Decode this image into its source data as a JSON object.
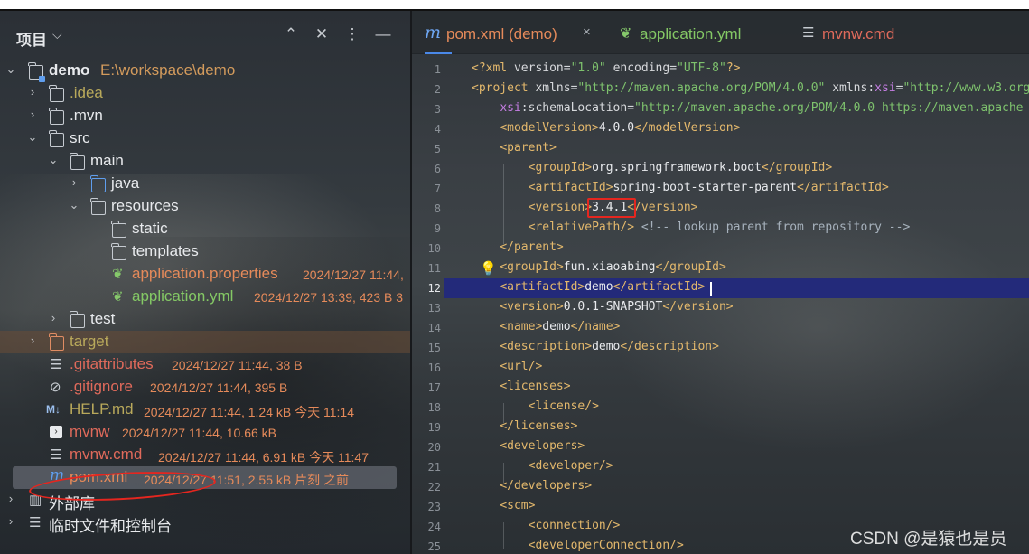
{
  "project_panel": {
    "title": "项目",
    "icons": [
      "expand-all-icon",
      "collapse-all-icon",
      "more-options-icon",
      "minimize-icon"
    ]
  },
  "tree": {
    "root": {
      "name": "demo",
      "path": "E:\\workspace\\demo"
    },
    "idea": ".idea",
    "mvn": ".mvn",
    "src": "src",
    "main": "main",
    "java": "java",
    "resources": "resources",
    "static": "static",
    "templates": "templates",
    "app_props": {
      "name": "application.properties",
      "meta": "2024/12/27 11:44,"
    },
    "app_yml": {
      "name": "application.yml",
      "meta": "2024/12/27 13:39, 423 B 3"
    },
    "test": "test",
    "target": "target",
    "gitattributes": {
      "name": ".gitattributes",
      "meta": "2024/12/27 11:44, 38 B"
    },
    "gitignore": {
      "name": ".gitignore",
      "meta": "2024/12/27 11:44, 395 B"
    },
    "help": {
      "name": "HELP.md",
      "meta": "2024/12/27 11:44, 1.24 kB 今天 11:14"
    },
    "mvnw": {
      "name": "mvnw",
      "meta": "2024/12/27 11:44, 10.66 kB"
    },
    "mvnw_cmd": {
      "name": "mvnw.cmd",
      "meta": "2024/12/27 11:44, 6.91 kB 今天 11:47"
    },
    "pom": {
      "name": "pom.xml",
      "meta": "2024/12/27 11:51, 2.55 kB 片刻 之前"
    },
    "ext_libs": "外部库",
    "scratches": "临时文件和控制台"
  },
  "tabs": [
    {
      "label": "pom.xml (demo)",
      "icon": "maven-icon",
      "active": true,
      "close": "×"
    },
    {
      "label": "application.yml",
      "icon": "spring-leaf-icon",
      "active": false
    },
    {
      "label": "mvnw.cmd",
      "icon": "script-lines-icon",
      "active": false
    }
  ],
  "editor": {
    "current_line": 12,
    "line_numbers": [
      "1",
      "2",
      "3",
      "4",
      "5",
      "6",
      "7",
      "8",
      "9",
      "10",
      "11",
      "12",
      "13",
      "14",
      "15",
      "16",
      "17",
      "18",
      "19",
      "20",
      "21",
      "22",
      "23",
      "24",
      "25"
    ]
  },
  "watermark": "CSDN @是猿也是员",
  "colors": {
    "tag": "#e3b86c",
    "string": "#7ec26d",
    "tab_underline": "#4a88e8",
    "current_line": "#232a7a",
    "annotation_red": "#e5261f"
  }
}
